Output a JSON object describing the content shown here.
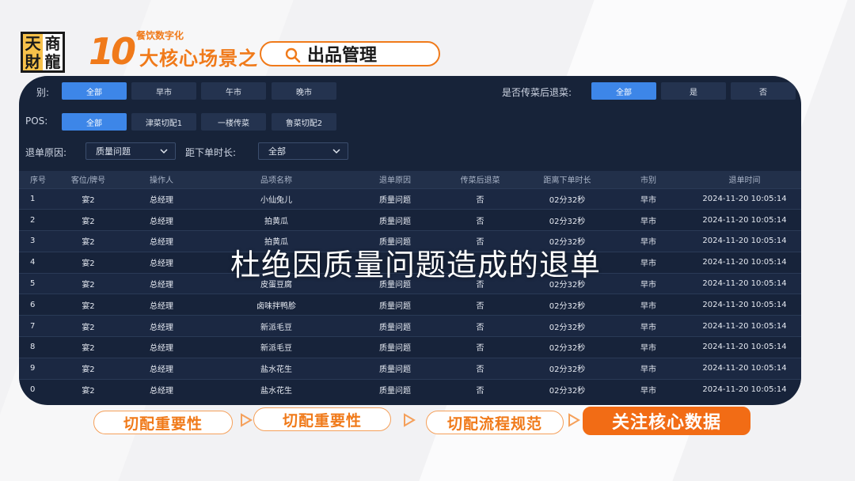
{
  "branding": {
    "logo_chars": [
      "天",
      "商",
      "財",
      "龍"
    ],
    "number": "10",
    "subtitle": "餐饮数字化",
    "headline": "大核心场景之",
    "search_text": "出品管理",
    "accent_color": "#f07a1a"
  },
  "filters": {
    "market_label": "别:",
    "market_options": [
      "全部",
      "早市",
      "午市",
      "晚市"
    ],
    "market_selected": "全部",
    "pos_label": "POS:",
    "pos_options": [
      "全部",
      "津菜切配1",
      "一楼传菜",
      "鲁菜切配2"
    ],
    "pos_selected": "全部",
    "return_after_label": "是否传菜后退菜:",
    "return_after_options": [
      "全部",
      "是",
      "否"
    ],
    "return_after_selected": "全部",
    "reason_label": "退单原因:",
    "reason_value": "质量问题",
    "elapsed_label": "距下单时长:",
    "elapsed_value": "全部"
  },
  "table": {
    "columns": [
      "序号",
      "客位/牌号",
      "操作人",
      "品项名称",
      "退单原因",
      "传菜后退菜",
      "距离下单时长",
      "市别",
      "退单时间"
    ],
    "rows": [
      [
        "1",
        "宴2",
        "总经理",
        "小仙兔儿",
        "质量问题",
        "否",
        "02分32秒",
        "早市",
        "2024-11-20 10:05:14"
      ],
      [
        "2",
        "宴2",
        "总经理",
        "拍黄瓜",
        "质量问题",
        "否",
        "02分32秒",
        "早市",
        "2024-11-20 10:05:14"
      ],
      [
        "3",
        "宴2",
        "总经理",
        "拍黄瓜",
        "质量问题",
        "否",
        "02分32秒",
        "早市",
        "2024-11-20 10:05:14"
      ],
      [
        "4",
        "宴2",
        "总经理",
        "",
        "",
        "",
        "",
        "早市",
        "2024-11-20 10:05:14"
      ],
      [
        "5",
        "宴2",
        "总经理",
        "皮蛋豆腐",
        "质量问题",
        "否",
        "02分32秒",
        "早市",
        "2024-11-20 10:05:14"
      ],
      [
        "6",
        "宴2",
        "总经理",
        "卤味拌鸭胗",
        "质量问题",
        "否",
        "02分32秒",
        "早市",
        "2024-11-20 10:05:14"
      ],
      [
        "7",
        "宴2",
        "总经理",
        "新派毛豆",
        "质量问题",
        "否",
        "02分32秒",
        "早市",
        "2024-11-20 10:05:14"
      ],
      [
        "8",
        "宴2",
        "总经理",
        "新派毛豆",
        "质量问题",
        "否",
        "02分32秒",
        "早市",
        "2024-11-20 10:05:14"
      ],
      [
        "9",
        "宴2",
        "总经理",
        "盐水花生",
        "质量问题",
        "否",
        "02分32秒",
        "早市",
        "2024-11-20 10:05:14"
      ],
      [
        "0",
        "宴2",
        "总经理",
        "盐水花生",
        "质量问题",
        "否",
        "02分32秒",
        "早市",
        "2024-11-20 10:05:14"
      ]
    ]
  },
  "overlay_caption": "杜绝因质量问题造成的退单",
  "steps": [
    "切配重要性",
    "切配重要性",
    "切配流程规范",
    "关注核心数据"
  ],
  "active_step": "关注核心数据",
  "colors": {
    "panel_bg": "#172339",
    "chip_active": "#3d86e8",
    "chip": "#24334f",
    "step_active": "#f26c15"
  }
}
